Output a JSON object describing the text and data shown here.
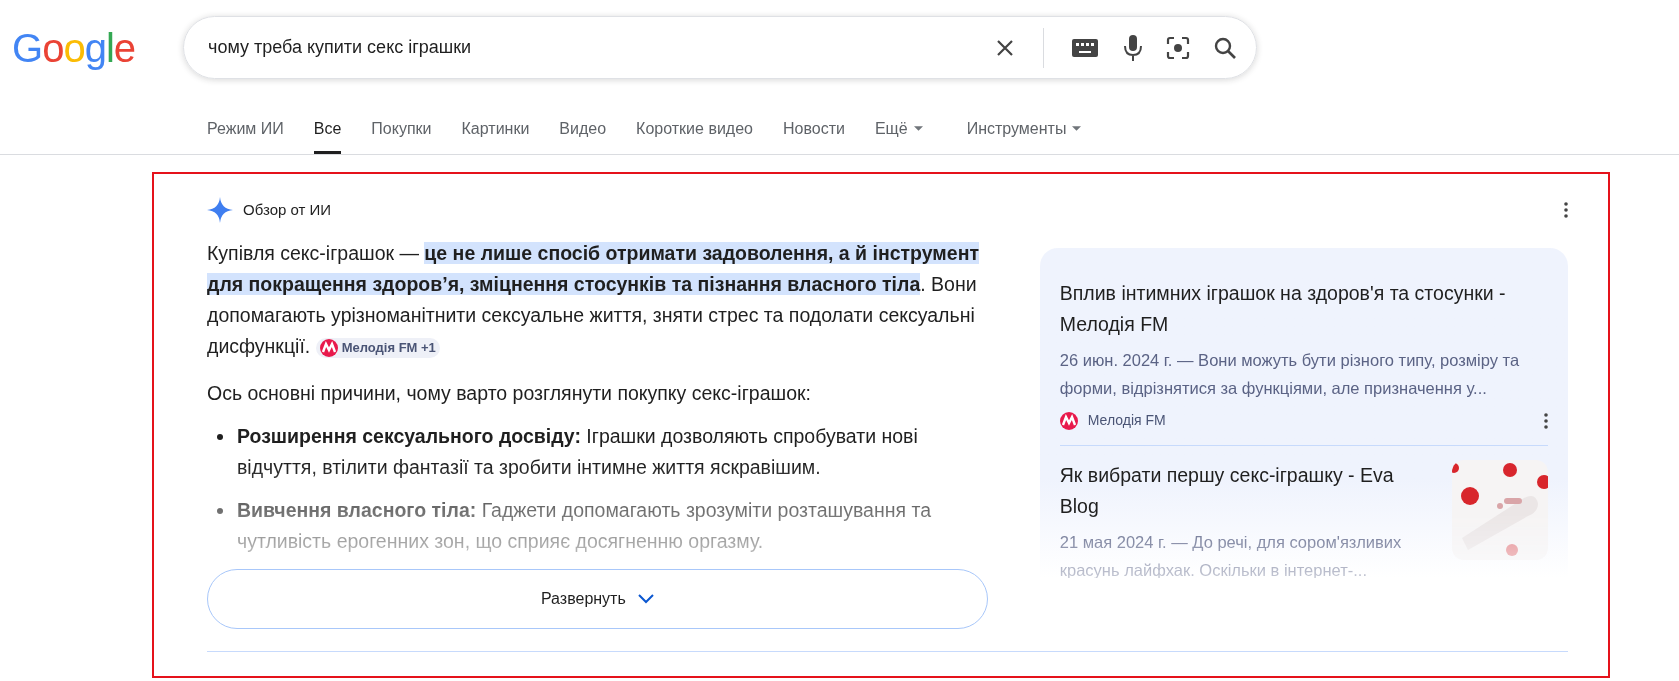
{
  "logo": [
    {
      "text": "G",
      "color": "#4285f4"
    },
    {
      "text": "o",
      "color": "#ea4335"
    },
    {
      "text": "o",
      "color": "#fbbc05"
    },
    {
      "text": "g",
      "color": "#4285f4"
    },
    {
      "text": "l",
      "color": "#34a853"
    },
    {
      "text": "e",
      "color": "#ea4335"
    }
  ],
  "search": {
    "value": "чому треба купити секс іграшки"
  },
  "tabs": [
    {
      "label": "Режим ИИ",
      "selected": false,
      "kind": "link"
    },
    {
      "label": "Все",
      "selected": true,
      "kind": "link"
    },
    {
      "label": "Покупки",
      "selected": false,
      "kind": "link"
    },
    {
      "label": "Картинки",
      "selected": false,
      "kind": "link"
    },
    {
      "label": "Видео",
      "selected": false,
      "kind": "link"
    },
    {
      "label": "Короткие видео",
      "selected": false,
      "kind": "link"
    },
    {
      "label": "Новости",
      "selected": false,
      "kind": "link"
    },
    {
      "label": "Ещё",
      "selected": false,
      "kind": "menu"
    },
    {
      "label": "Инструменты",
      "selected": false,
      "kind": "menu"
    }
  ],
  "overview": {
    "title": "Обзор от ИИ",
    "intro": "Купівля секс-іграшок — ",
    "highlight": "це не лише спосіб отримати задоволення, а й інструмент для покращення здоров’я, зміцнення стосунків та пізнання власного тіла",
    "rest": ". Вони допомагають урізноманітнити сексуальне життя, зняти стрес та подолати сексуальні дисфункції.",
    "source_chip": "Мелодія FM +1",
    "lead": "Ось основні причини, чому варто розглянути покупку секс-іграшок:",
    "bullets": [
      {
        "bold": "Розширення сексуального досвіду:",
        "text": "Іграшки дозволяють спробувати нові відчуття, втілити фантазії та зробити інтимне життя яскравішим."
      },
      {
        "bold": "Вивчення власного тіла:",
        "text": "Гаджети допомагають зрозуміти розташування та чутливість ерогенних зон, що сприяє досягненню оргазму."
      }
    ],
    "expand_button": "Развернуть"
  },
  "sources": [
    {
      "title": "Вплив інтимних іграшок на здоров'я та стосунки - Мелодія FM",
      "snippet": "26 июн. 2024 г. — Вони можуть бути різного типу, розміру та форми, відрізнятися за функціями, але призначення у...",
      "site": "Мелодія FM"
    },
    {
      "title": "Як вибрати першу секс-іграшку - Eva Blog",
      "snippet": "21 мая 2024 г. — До речі, для сором'язливих красунь лайфхак. Оскільки в інтернет-..."
    }
  ]
}
